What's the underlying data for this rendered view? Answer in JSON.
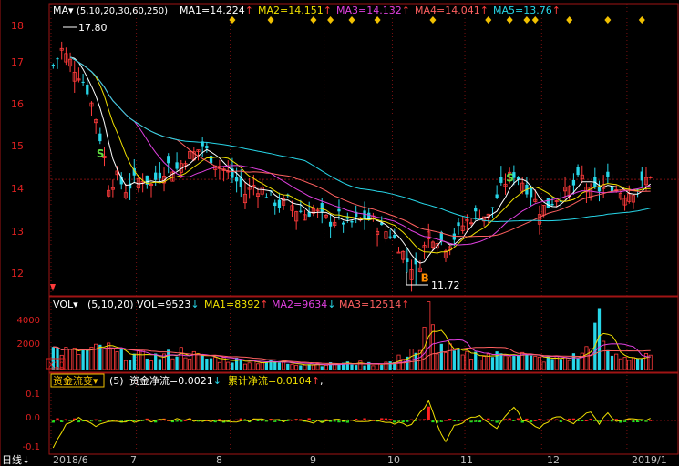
{
  "colors": {
    "background": "#000000",
    "grid": "#7a1010",
    "frame": "#a01414",
    "up": "#ff3b3b",
    "down": "#27d6e8",
    "ma1": "#ffffff",
    "ma2": "#f0e000",
    "ma3": "#e040e0",
    "ma4": "#ff6060",
    "ma5": "#27d6e8",
    "flow_pos": "#ff2020",
    "flow_neg": "#20e020",
    "signal": "#f0c000"
  },
  "price_panel": {
    "indicator_label": "MA",
    "indicator_arrow": "▾",
    "params": "(5,10,20,30,60,250)",
    "ma_values": [
      {
        "label": "MA1=14.224",
        "arrow": "↑"
      },
      {
        "label": "MA2=14.151",
        "arrow": "↑"
      },
      {
        "label": "MA3=14.132",
        "arrow": "↑"
      },
      {
        "label": "MA4=14.041",
        "arrow": "↑"
      },
      {
        "label": "MA5=13.76",
        "arrow": "↑"
      }
    ],
    "high_label": "17.80",
    "low_label": "11.72",
    "ylim": [
      11.5,
      18.3
    ],
    "yticks": [
      "18",
      "17",
      "16",
      "15",
      "14",
      "13",
      "12"
    ],
    "reference_price": 14.35
  },
  "volume_panel": {
    "indicator_label": "VOL",
    "indicator_arrow": "▾",
    "params": "(5,10,20)",
    "vol_label": "VOL=9523",
    "vol_arrow": "↓",
    "ma_values": [
      {
        "label": "MA1=8392",
        "arrow": "↑"
      },
      {
        "label": "MA2=9634",
        "arrow": "↓"
      },
      {
        "label": "MA3=12514",
        "arrow": "↑"
      }
    ],
    "yticks": [
      "4000",
      "2000"
    ],
    "unit": "X10",
    "ylim": [
      0,
      4500
    ]
  },
  "flow_panel": {
    "indicator_label": "资金流变",
    "indicator_arrow": "▾",
    "params": "(5)",
    "net_label": "资金净流=0.0021",
    "net_arrow": "↓",
    "cum_label": "累计净流=0.0104",
    "cum_arrow": "↑",
    "trailing": ",",
    "yticks": [
      "0.1",
      "0.0",
      "-0.1"
    ],
    "ylim": [
      -0.13,
      0.13
    ]
  },
  "x_axis": {
    "period_label": "日线",
    "period_arrow": "↓",
    "ticks": [
      "2018/6",
      "7",
      "8",
      "9",
      "10",
      "11",
      "12",
      "2019/1"
    ]
  },
  "chart_data": {
    "type": "candlestick",
    "title": "",
    "x_range": [
      "2018/6",
      "2019/1"
    ],
    "month_start_bars": [
      0,
      20,
      42,
      64,
      80,
      97,
      115,
      135
    ],
    "bars": 141,
    "close_anchors": [
      [
        0,
        17.2
      ],
      [
        2,
        17.6
      ],
      [
        4,
        17.3
      ],
      [
        6,
        17.0
      ],
      [
        8,
        16.6
      ],
      [
        10,
        15.9
      ],
      [
        12,
        14.9
      ],
      [
        13,
        14.2
      ],
      [
        15,
        14.4
      ],
      [
        17,
        14.1
      ],
      [
        19,
        14.3
      ],
      [
        21,
        14.4
      ],
      [
        23,
        14.2
      ],
      [
        25,
        14.5
      ],
      [
        27,
        14.7
      ],
      [
        29,
        14.6
      ],
      [
        31,
        14.9
      ],
      [
        33,
        15.0
      ],
      [
        35,
        15.2
      ],
      [
        37,
        14.9
      ],
      [
        39,
        14.7
      ],
      [
        41,
        14.5
      ],
      [
        43,
        14.3
      ],
      [
        45,
        14.0
      ],
      [
        47,
        14.2
      ],
      [
        49,
        14.1
      ],
      [
        51,
        13.9
      ],
      [
        53,
        13.7
      ],
      [
        55,
        13.8
      ],
      [
        57,
        13.6
      ],
      [
        59,
        13.5
      ],
      [
        61,
        13.6
      ],
      [
        63,
        13.4
      ],
      [
        65,
        13.3
      ],
      [
        67,
        13.4
      ],
      [
        69,
        13.2
      ],
      [
        71,
        13.3
      ],
      [
        73,
        13.4
      ],
      [
        75,
        13.3
      ],
      [
        77,
        13.1
      ],
      [
        79,
        13.0
      ],
      [
        81,
        12.7
      ],
      [
        83,
        12.3
      ],
      [
        85,
        12.1
      ],
      [
        86,
        12.3
      ],
      [
        88,
        13.0
      ],
      [
        90,
        12.9
      ],
      [
        92,
        12.7
      ],
      [
        94,
        12.9
      ],
      [
        96,
        13.2
      ],
      [
        98,
        13.4
      ],
      [
        100,
        13.5
      ],
      [
        102,
        13.4
      ],
      [
        104,
        13.9
      ],
      [
        106,
        14.3
      ],
      [
        108,
        14.5
      ],
      [
        110,
        14.3
      ],
      [
        112,
        14.0
      ],
      [
        114,
        13.6
      ],
      [
        116,
        13.7
      ],
      [
        118,
        13.9
      ],
      [
        120,
        14.0
      ],
      [
        122,
        14.2
      ],
      [
        124,
        14.4
      ],
      [
        126,
        14.0
      ],
      [
        128,
        14.1
      ],
      [
        130,
        14.3
      ],
      [
        132,
        14.1
      ],
      [
        134,
        14.0
      ],
      [
        136,
        14.1
      ],
      [
        138,
        14.2
      ],
      [
        140,
        14.5
      ]
    ],
    "volume_anchors": [
      [
        0,
        1600
      ],
      [
        5,
        1300
      ],
      [
        10,
        1500
      ],
      [
        12,
        1800
      ],
      [
        15,
        1200
      ],
      [
        20,
        1100
      ],
      [
        25,
        1000
      ],
      [
        30,
        1400
      ],
      [
        35,
        900
      ],
      [
        40,
        800
      ],
      [
        45,
        700
      ],
      [
        50,
        600
      ],
      [
        55,
        500
      ],
      [
        60,
        450
      ],
      [
        65,
        420
      ],
      [
        70,
        500
      ],
      [
        75,
        450
      ],
      [
        80,
        600
      ],
      [
        84,
        1600
      ],
      [
        86,
        1200
      ],
      [
        88,
        4300
      ],
      [
        90,
        1800
      ],
      [
        93,
        1500
      ],
      [
        96,
        1000
      ],
      [
        100,
        1200
      ],
      [
        104,
        1100
      ],
      [
        108,
        1500
      ],
      [
        112,
        900
      ],
      [
        116,
        800
      ],
      [
        120,
        900
      ],
      [
        124,
        1100
      ],
      [
        126,
        2400
      ],
      [
        128,
        3600
      ],
      [
        130,
        1200
      ],
      [
        134,
        1000
      ],
      [
        138,
        900
      ],
      [
        140,
        950
      ]
    ],
    "flow_anchors": [
      [
        0,
        -0.12
      ],
      [
        3,
        -0.01
      ],
      [
        6,
        0.01
      ],
      [
        10,
        -0.02
      ],
      [
        14,
        0.0
      ],
      [
        20,
        -0.005
      ],
      [
        30,
        0.005
      ],
      [
        40,
        -0.005
      ],
      [
        50,
        0.004
      ],
      [
        60,
        -0.006
      ],
      [
        70,
        0.003
      ],
      [
        80,
        -0.01
      ],
      [
        84,
        -0.02
      ],
      [
        88,
        0.08
      ],
      [
        90,
        -0.02
      ],
      [
        92,
        -0.09
      ],
      [
        94,
        -0.02
      ],
      [
        98,
        0.01
      ],
      [
        100,
        0.02
      ],
      [
        104,
        -0.03
      ],
      [
        108,
        0.06
      ],
      [
        110,
        0.0
      ],
      [
        114,
        -0.03
      ],
      [
        118,
        0.02
      ],
      [
        122,
        -0.01
      ],
      [
        126,
        0.04
      ],
      [
        128,
        -0.01
      ],
      [
        130,
        0.03
      ],
      [
        132,
        0.0
      ],
      [
        136,
        0.01
      ],
      [
        140,
        0.005
      ]
    ],
    "signals": [
      {
        "label": "S",
        "bar": 11,
        "price": 14.9
      },
      {
        "label": "B",
        "bar": 87,
        "price": 12.1
      },
      {
        "label": "S",
        "bar": 107,
        "price": 14.3
      }
    ],
    "events_markers_bars": [
      42,
      51,
      61,
      65,
      70,
      76,
      89,
      102,
      107,
      111,
      113,
      121,
      130,
      138
    ]
  }
}
